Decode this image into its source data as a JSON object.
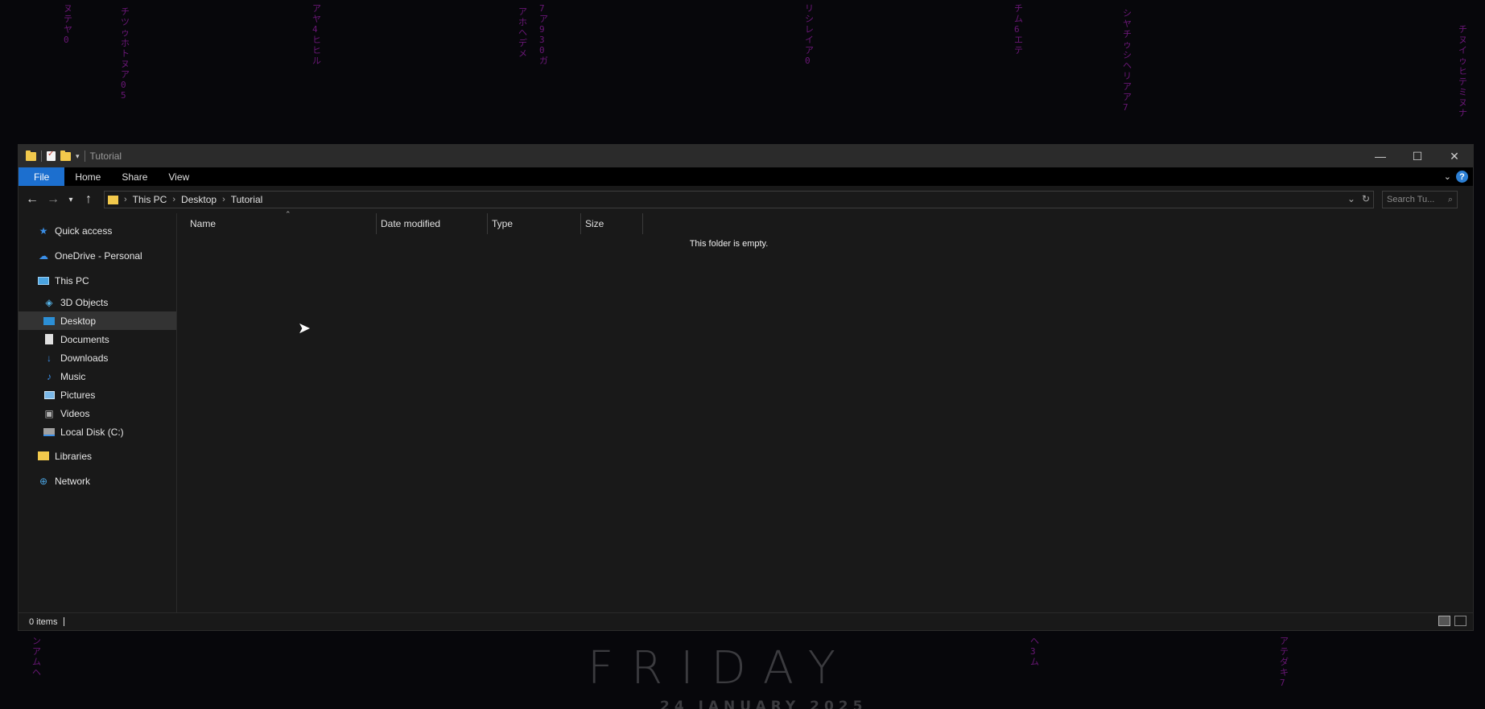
{
  "window": {
    "title": "Tutorial",
    "controls": {
      "minimize": "—",
      "maximize": "☐",
      "close": "✕"
    }
  },
  "ribbon": {
    "tabs": [
      "File",
      "Home",
      "Share",
      "View"
    ],
    "help": "?"
  },
  "address": {
    "crumbs": [
      "This PC",
      "Desktop",
      "Tutorial"
    ],
    "search_placeholder": "Search Tu..."
  },
  "navpane": {
    "items": [
      {
        "label": "Quick access",
        "icon": "star-icon",
        "color": "#3a8ee6"
      },
      {
        "label": "OneDrive - Personal",
        "icon": "cloud-icon",
        "color": "#3a8ee6"
      },
      {
        "label": "This PC",
        "icon": "computer-icon",
        "color": "#4aa3e0"
      },
      {
        "label": "3D Objects",
        "icon": "cube-icon",
        "color": "#56b4e9"
      },
      {
        "label": "Desktop",
        "icon": "desktop-icon",
        "color": "#2c8fd6",
        "selected": true
      },
      {
        "label": "Documents",
        "icon": "document-icon",
        "color": "#d0d0d0"
      },
      {
        "label": "Downloads",
        "icon": "download-icon",
        "color": "#3a8ee6"
      },
      {
        "label": "Music",
        "icon": "music-icon",
        "color": "#3a8ee6"
      },
      {
        "label": "Pictures",
        "icon": "pictures-icon",
        "color": "#7ab8e8"
      },
      {
        "label": "Videos",
        "icon": "video-icon",
        "color": "#b0b0b0"
      },
      {
        "label": "Local Disk (C:)",
        "icon": "disk-icon",
        "color": "#b0b0b0"
      },
      {
        "label": "Libraries",
        "icon": "libraries-icon",
        "color": "#f2c94c"
      },
      {
        "label": "Network",
        "icon": "network-icon",
        "color": "#4aa3e0"
      }
    ]
  },
  "content": {
    "columns": [
      "Name",
      "Date modified",
      "Type",
      "Size"
    ],
    "empty_message": "This folder is empty."
  },
  "status": {
    "count": "0 items"
  },
  "wallpaper": {
    "title": "FRIDAY",
    "date": "24 JANUARY 2025"
  }
}
